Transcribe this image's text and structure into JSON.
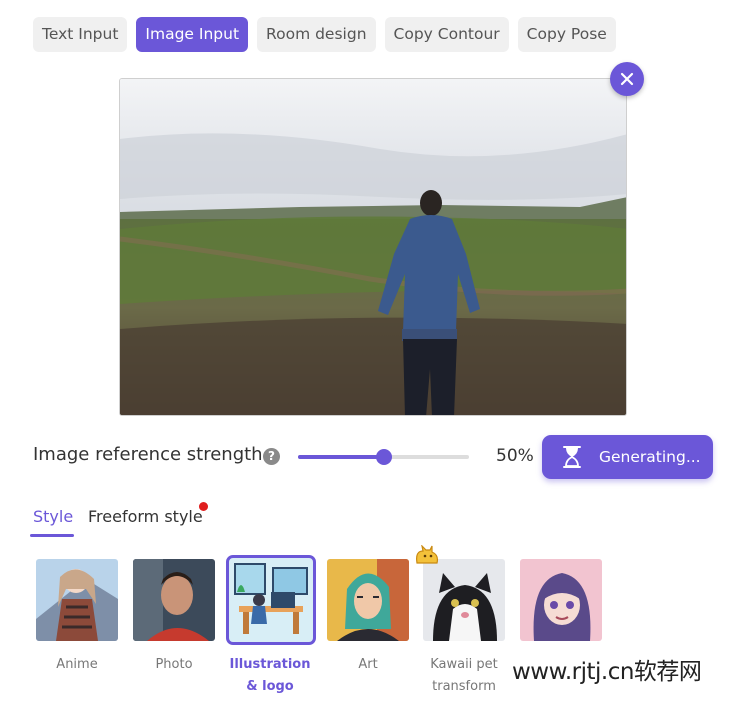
{
  "tabs": [
    {
      "label": "Text Input"
    },
    {
      "label": "Image Input",
      "active": true
    },
    {
      "label": "Room design"
    },
    {
      "label": "Copy Contour"
    },
    {
      "label": "Copy Pose"
    }
  ],
  "preview": {
    "close_icon": "close-icon"
  },
  "strength": {
    "label": "Image reference strength",
    "help_icon": "question-icon",
    "value": 50,
    "value_text": "50%"
  },
  "generate": {
    "label": "Generating...",
    "icon": "hourglass-icon"
  },
  "style_tabs": [
    {
      "label": "Style",
      "active": true
    },
    {
      "label": "Freeform style",
      "badge": "red-dot"
    }
  ],
  "styles": [
    {
      "label": "Anime"
    },
    {
      "label": "Photo"
    },
    {
      "label_line1": "Illustration",
      "label_line2": "& logo",
      "selected": true
    },
    {
      "label": "Art"
    },
    {
      "label_line1": "Kawaii pet",
      "label_line2": "transform",
      "badge_icon": "cat-badge-icon"
    },
    {
      "label": ""
    }
  ],
  "watermark": "www.rjtj.cn软荐网",
  "colors": {
    "accent": "#6b57d8",
    "badge": "#e01e1e"
  }
}
